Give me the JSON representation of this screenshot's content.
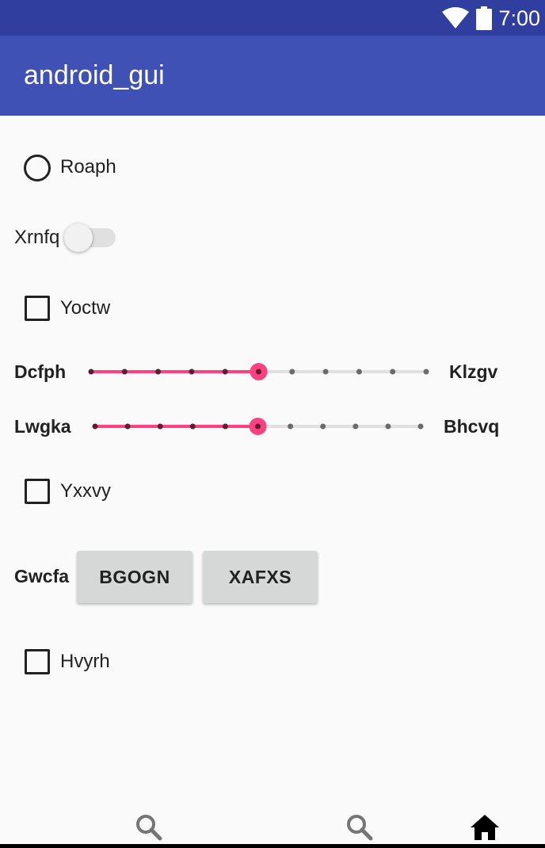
{
  "status_bar": {
    "time": "7:00",
    "icons": [
      "wifi-icon",
      "battery-icon"
    ]
  },
  "app_bar": {
    "title": "android_gui"
  },
  "content": {
    "radio": {
      "label": "Roaph",
      "checked": false
    },
    "switch": {
      "label": "Xrnfq",
      "on": false
    },
    "checkbox_1": {
      "label": "Yoctw",
      "checked": false
    },
    "slider_1": {
      "left_label": "Dcfph",
      "right_label": "Klzgv",
      "value": 5,
      "max": 10
    },
    "slider_2": {
      "left_label": "Lwgka",
      "right_label": "Bhcvq",
      "value": 5,
      "max": 10
    },
    "checkbox_2": {
      "label": "Yxxvy",
      "checked": false
    },
    "button_row": {
      "label": "Gwcfa",
      "button_1": "BGOGN",
      "button_2": "XAFXS"
    },
    "checkbox_3": {
      "label": "Hvyrh",
      "checked": false
    }
  },
  "bottom_nav": {
    "items": [
      "search-icon",
      "search-icon",
      "home-icon"
    ]
  },
  "colors": {
    "status_bar": "#303f9f",
    "app_bar": "#3f51b5",
    "accent": "#ff4081",
    "slider_track": "#e0e0e0",
    "button": "#d6d7d7"
  }
}
